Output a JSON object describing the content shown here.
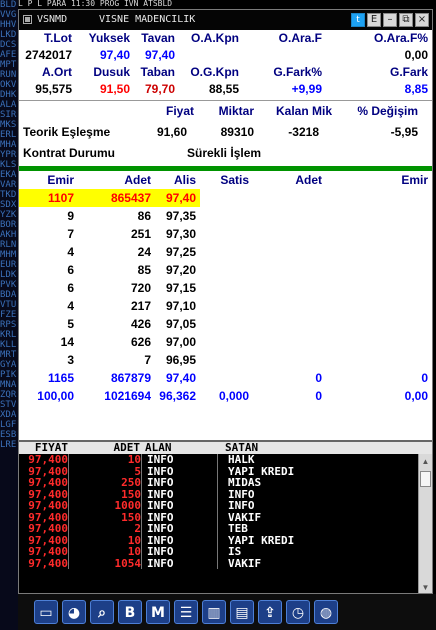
{
  "topstrip": {
    "text": "   L   P    L   PARA   11:30   PROG   IVN   ATSBLD"
  },
  "leftstrip": {
    "text": "BLDVVGHHVLKDDCSAFEMPTRUNOKVDHKALASIRMKSERLMHAYPRKLSEKAVARTKDSDXYZKBORAKHRLNMHMEURLDKPVKBDAVTUFZERPSKRLKLLMRTGYAPIKMNAZQRSTVXDALGFESBLRE"
  },
  "titlebar": {
    "code": "VSNMD",
    "name": "VISNE MADENCILIK",
    "btn_twitter": "t",
    "btn_e": "E",
    "btn_min": "–",
    "btn_restore": "⧉",
    "btn_close": "×"
  },
  "stats": {
    "headers1": [
      "T.Lot",
      "Yuksek",
      "Tavan",
      "O.A.Kpn",
      "O.Ara.F",
      "O.Ara.F%"
    ],
    "values1": [
      "2742017",
      "97,40",
      "97,40",
      "",
      "",
      "0,00"
    ],
    "headers2": [
      "A.Ort",
      "Dusuk",
      "Taban",
      "O.G.Kpn",
      "G.Fark%",
      "G.Fark"
    ],
    "values2": [
      "95,575",
      "91,50",
      "79,70",
      "88,55",
      "+9,99",
      "8,85"
    ]
  },
  "theoretical": {
    "headers": [
      "Fiyat",
      "Miktar",
      "Kalan Mik",
      "% Değişim"
    ],
    "label": "Teorik Eşleşme",
    "values": [
      "91,60",
      "89310",
      "-3218",
      "-5,95"
    ],
    "contract_label": "Kontrat Durumu",
    "contract_value": "Sürekli İşlem"
  },
  "book": {
    "headers": [
      "Emir",
      "Adet",
      "Alis",
      "Satis",
      "Adet",
      "Emir"
    ],
    "rows": [
      [
        "1107",
        "865437",
        "97,40",
        "",
        "",
        ""
      ],
      [
        "9",
        "86",
        "97,35",
        "",
        "",
        ""
      ],
      [
        "7",
        "251",
        "97,30",
        "",
        "",
        ""
      ],
      [
        "4",
        "24",
        "97,25",
        "",
        "",
        ""
      ],
      [
        "6",
        "85",
        "97,20",
        "",
        "",
        ""
      ],
      [
        "6",
        "720",
        "97,15",
        "",
        "",
        ""
      ],
      [
        "4",
        "217",
        "97,10",
        "",
        "",
        ""
      ],
      [
        "5",
        "426",
        "97,05",
        "",
        "",
        ""
      ],
      [
        "14",
        "626",
        "97,00",
        "",
        "",
        ""
      ],
      [
        "3",
        "7",
        "96,95",
        "",
        "",
        ""
      ]
    ],
    "total1": [
      "1165",
      "867879",
      "97,40",
      "",
      "0",
      "0"
    ],
    "total2": [
      "100,00",
      "1021694",
      "96,362",
      "0,000",
      "0",
      "0,00"
    ]
  },
  "trades": {
    "headers": [
      "FIYAT",
      "ADET",
      "ALAN",
      "SATAN"
    ],
    "rows": [
      [
        "97,400",
        "10",
        "INFO",
        "HALK"
      ],
      [
        "97,400",
        "5",
        "INFO",
        "YAPI KREDI"
      ],
      [
        "97,400",
        "250",
        "INFO",
        "MIDAS"
      ],
      [
        "97,400",
        "150",
        "INFO",
        "INFO"
      ],
      [
        "97,400",
        "1000",
        "INFO",
        "INFO"
      ],
      [
        "97,400",
        "150",
        "INFO",
        "VAKIF"
      ],
      [
        "97,400",
        "2",
        "INFO",
        "TEB"
      ],
      [
        "97,400",
        "10",
        "INFO",
        "YAPI KREDI"
      ],
      [
        "97,400",
        "10",
        "INFO",
        "IS"
      ],
      [
        "97,400",
        "1054",
        "INFO",
        "VAKIF"
      ]
    ]
  },
  "dock": {
    "items": [
      {
        "name": "monitor-icon",
        "glyph": "▭"
      },
      {
        "name": "pie-chart-icon",
        "glyph": "◕"
      },
      {
        "name": "document-search-icon",
        "glyph": "⌕"
      },
      {
        "name": "b-icon",
        "glyph": "B"
      },
      {
        "name": "m-icon",
        "glyph": "M"
      },
      {
        "name": "list-icon",
        "glyph": "☰"
      },
      {
        "name": "bar-chart-icon",
        "glyph": "▥"
      },
      {
        "name": "news-icon",
        "glyph": "▤"
      },
      {
        "name": "upload-icon",
        "glyph": "⇪"
      },
      {
        "name": "clock-icon",
        "glyph": "◷"
      },
      {
        "name": "globe-icon",
        "glyph": "◍"
      }
    ]
  },
  "colors": {
    "accent_green": "#009300",
    "highlight_yellow": "#ffff00",
    "price_red": "#ff0000",
    "header_navy": "#000080",
    "link_blue": "#0000ff"
  }
}
